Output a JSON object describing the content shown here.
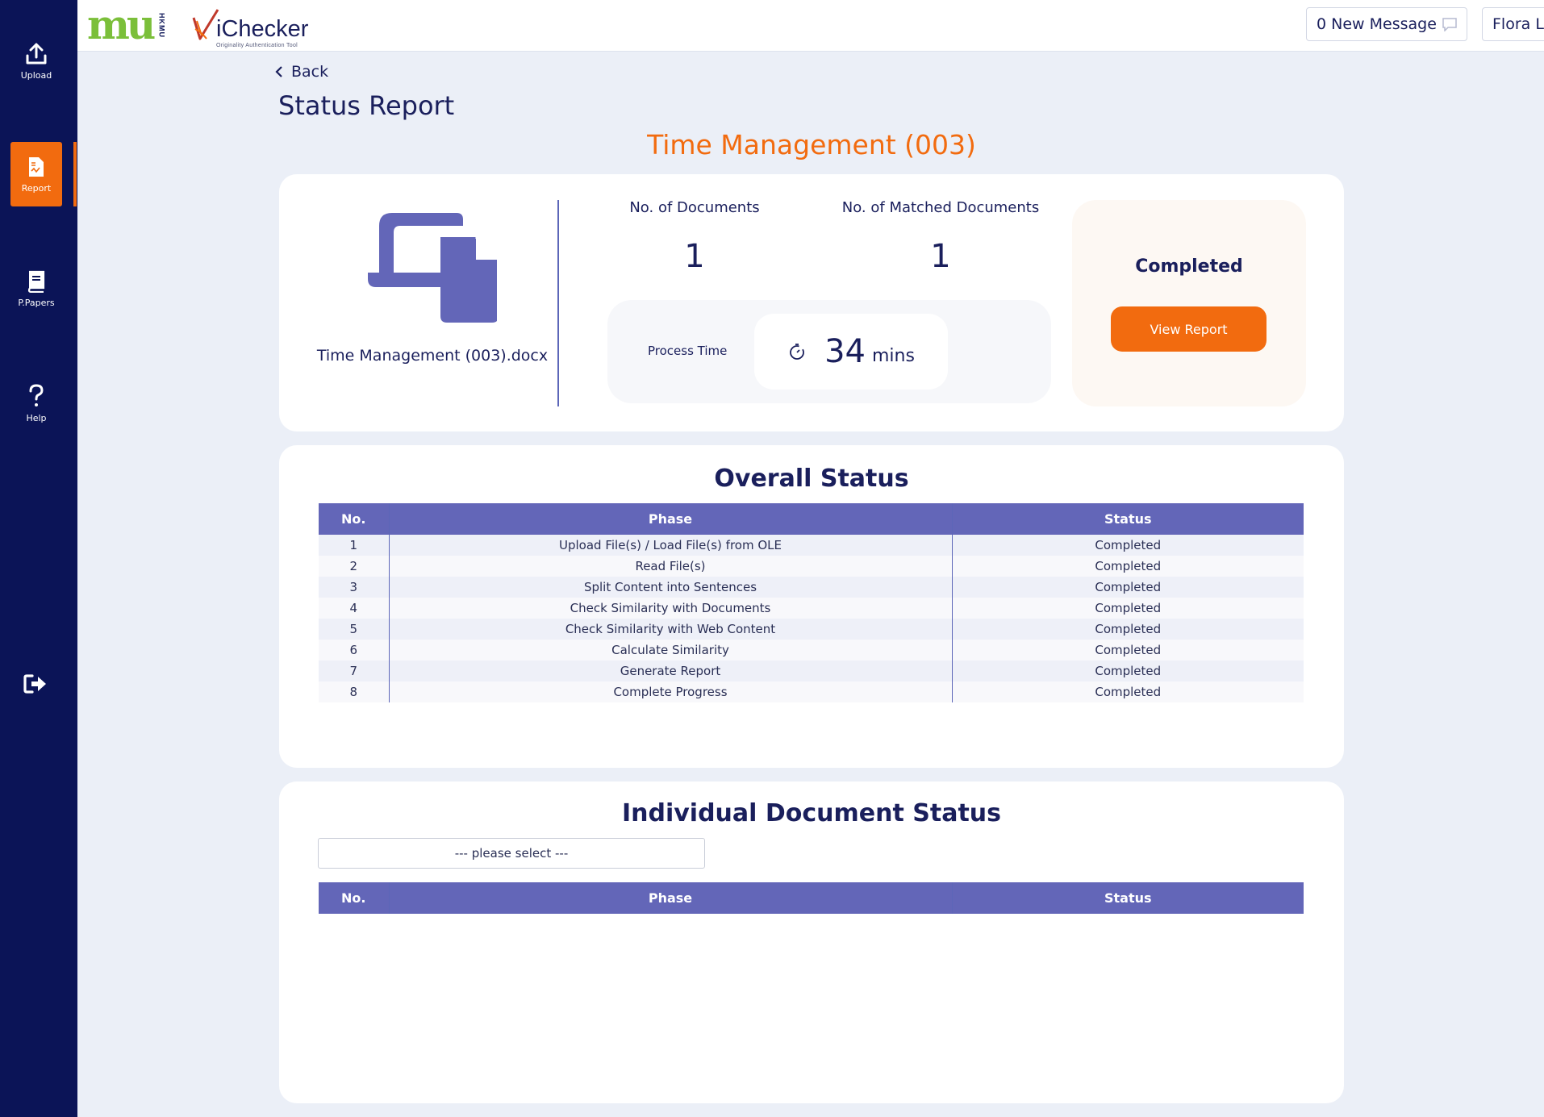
{
  "sidebar": {
    "items": [
      {
        "label": "Upload",
        "icon": "upload-icon"
      },
      {
        "label": "Report",
        "icon": "report-icon",
        "active": true
      },
      {
        "label": "P.Papers",
        "icon": "book-icon"
      },
      {
        "label": "Help",
        "icon": "help-icon"
      }
    ],
    "logout_icon": "logout-icon"
  },
  "header": {
    "logo_mu": "mu",
    "logo_hkmu": "HKMU",
    "logo_name": "iChecker",
    "logo_tagline": "Originality Authentication Tool",
    "messages_label": "0 New Message",
    "user_name": "Flora Lau"
  },
  "page": {
    "back_label": "Back",
    "title": "Status Report",
    "subtitle": "Time Management (003)"
  },
  "summary": {
    "file_name": "Time Management (003).docx",
    "documents_label": "No. of Documents",
    "documents_value": "1",
    "matched_label": "No. of Matched Documents",
    "matched_value": "1",
    "process_label": "Process Time",
    "process_value": "34",
    "process_unit": "mins",
    "status_text": "Completed",
    "view_report_label": "View Report"
  },
  "overall": {
    "title": "Overall Status",
    "columns": [
      "No.",
      "Phase",
      "Status"
    ],
    "rows": [
      {
        "no": "1",
        "phase": "Upload File(s) / Load File(s) from OLE",
        "status": "Completed"
      },
      {
        "no": "2",
        "phase": "Read File(s)",
        "status": "Completed"
      },
      {
        "no": "3",
        "phase": "Split Content into Sentences",
        "status": "Completed"
      },
      {
        "no": "4",
        "phase": "Check Similarity with Documents",
        "status": "Completed"
      },
      {
        "no": "5",
        "phase": "Check Similarity with Web Content",
        "status": "Completed"
      },
      {
        "no": "6",
        "phase": "Calculate Similarity",
        "status": "Completed"
      },
      {
        "no": "7",
        "phase": "Generate Report",
        "status": "Completed"
      },
      {
        "no": "8",
        "phase": "Complete Progress",
        "status": "Completed"
      }
    ]
  },
  "individual": {
    "title": "Individual Document Status",
    "select_placeholder": "--- please select ---",
    "columns": [
      "No.",
      "Phase",
      "Status"
    ]
  },
  "colors": {
    "sidebar_bg": "#0b1457",
    "accent": "#f26b0f",
    "table_header": "#6366b8",
    "page_bg": "#ebeff7"
  }
}
